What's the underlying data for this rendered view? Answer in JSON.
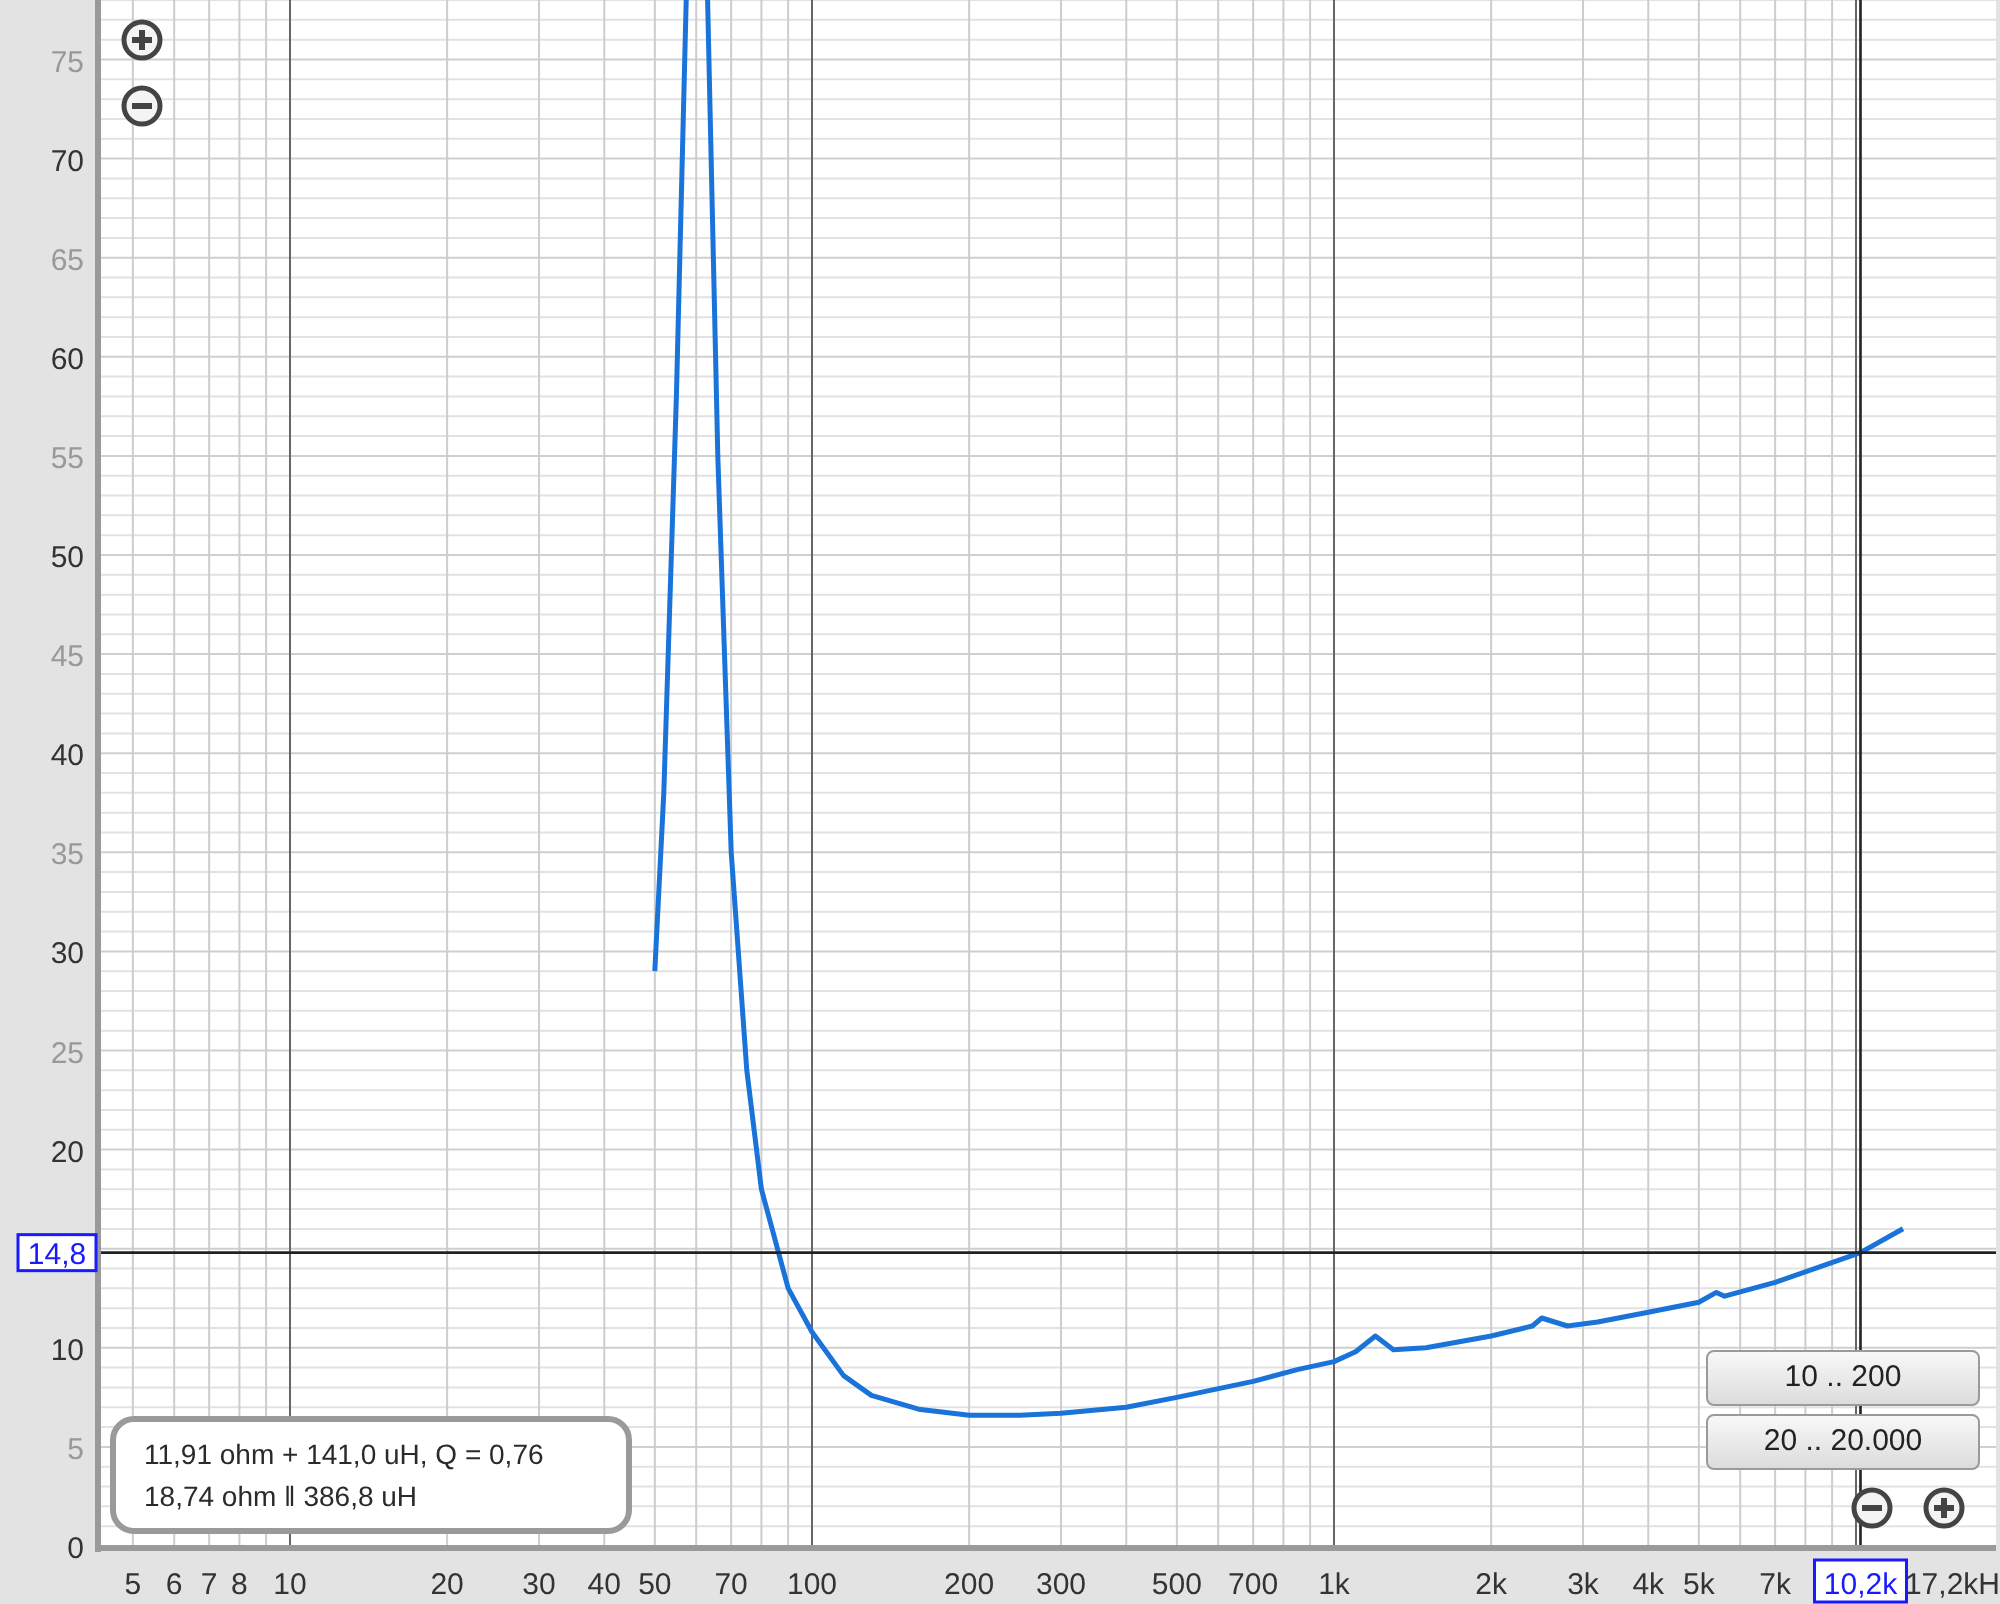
{
  "plot": {
    "y_axis_labels": [
      {
        "text": "75",
        "muted": true
      },
      {
        "text": "70",
        "muted": false
      },
      {
        "text": "65",
        "muted": true
      },
      {
        "text": "60",
        "muted": false
      },
      {
        "text": "55",
        "muted": true
      },
      {
        "text": "50",
        "muted": false
      },
      {
        "text": "45",
        "muted": true
      },
      {
        "text": "40",
        "muted": false
      },
      {
        "text": "35",
        "muted": true
      },
      {
        "text": "30",
        "muted": false
      },
      {
        "text": "25",
        "muted": true
      },
      {
        "text": "20",
        "muted": false
      },
      {
        "text": "10",
        "muted": false
      },
      {
        "text": "5",
        "muted": true
      },
      {
        "text": "0",
        "muted": false
      }
    ],
    "x_axis_labels": [
      "5",
      "6",
      "7",
      "8",
      "10",
      "20",
      "30",
      "40",
      "50",
      "70",
      "100",
      "200",
      "300",
      "500",
      "700",
      "1k",
      "2k",
      "3k",
      "4k",
      "5k",
      "7k"
    ],
    "x_end_label": "17,2kH",
    "cursor": {
      "x_label": "10,2k",
      "y_label": "14,8"
    }
  },
  "fit_info": {
    "lines": [
      "11,91 ohm + 141,0 uH, Q = 0,76",
      "18,74 ohm ‖ 386,8 uH"
    ]
  },
  "range_buttons": [
    "10 .. 200",
    "20 .. 20.000"
  ]
}
